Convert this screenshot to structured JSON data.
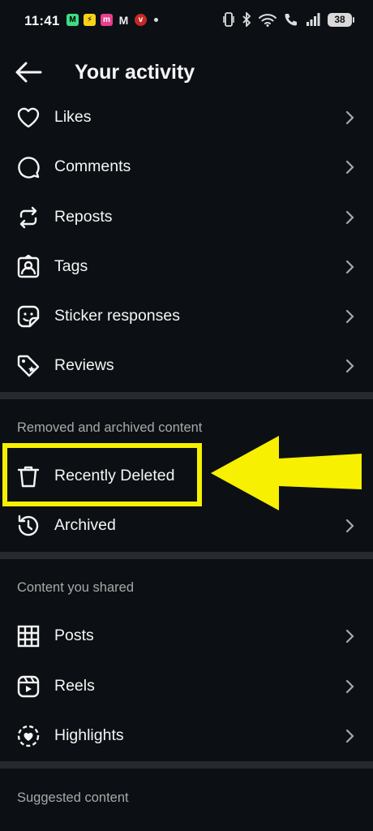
{
  "status_bar": {
    "time": "11:41",
    "battery": "38"
  },
  "header": {
    "title": "Your activity"
  },
  "interactions": [
    {
      "label": "Likes",
      "icon": "heart-icon"
    },
    {
      "label": "Comments",
      "icon": "comment-icon"
    },
    {
      "label": "Reposts",
      "icon": "repost-icon"
    },
    {
      "label": "Tags",
      "icon": "tag-person-icon"
    },
    {
      "label": "Sticker responses",
      "icon": "sticker-icon"
    },
    {
      "label": "Reviews",
      "icon": "review-tag-icon"
    }
  ],
  "removed_section": {
    "title": "Removed and archived content",
    "items": [
      {
        "label": "Recently Deleted",
        "icon": "trash-icon"
      },
      {
        "label": "Archived",
        "icon": "archive-history-icon"
      }
    ]
  },
  "shared_section": {
    "title": "Content you shared",
    "items": [
      {
        "label": "Posts",
        "icon": "grid-icon"
      },
      {
        "label": "Reels",
        "icon": "reels-icon"
      },
      {
        "label": "Highlights",
        "icon": "highlights-icon"
      }
    ]
  },
  "suggested_section": {
    "title": "Suggested content"
  },
  "annotation": {
    "highlight_color": "#f7f000"
  }
}
